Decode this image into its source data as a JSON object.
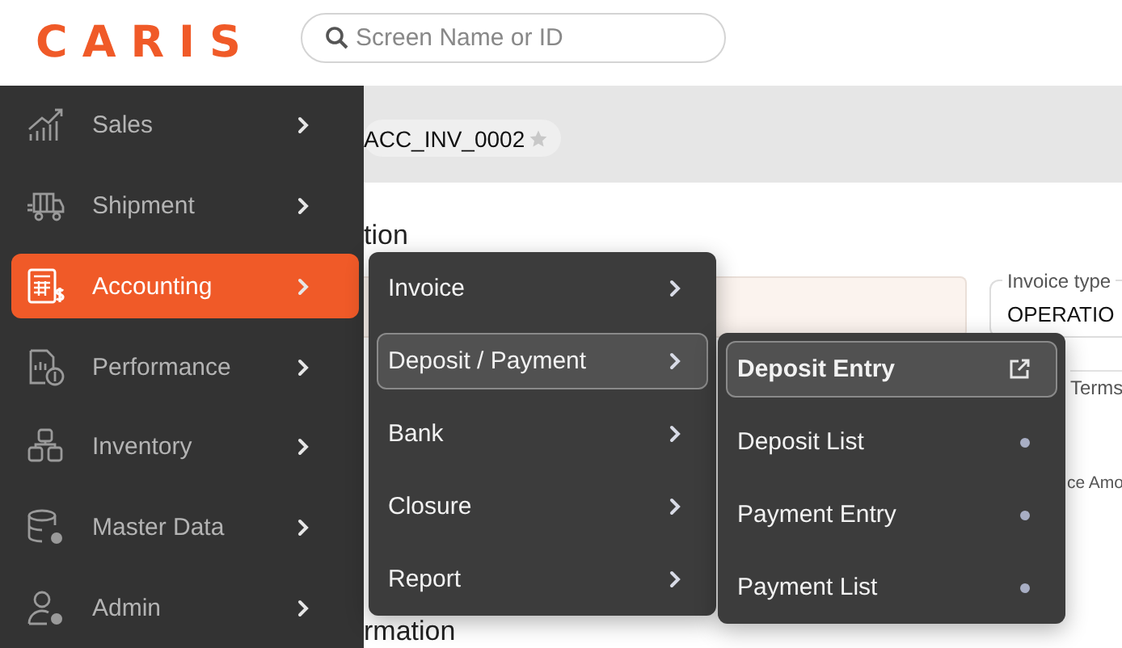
{
  "header": {
    "logo": "CARIS",
    "search": {
      "placeholder": "Screen Name or ID"
    }
  },
  "sidebar": {
    "items": [
      {
        "label": "Sales",
        "selected": false
      },
      {
        "label": "Shipment",
        "selected": false
      },
      {
        "label": "Accounting",
        "selected": true
      },
      {
        "label": "Performance",
        "selected": false
      },
      {
        "label": "Inventory",
        "selected": false
      },
      {
        "label": "Master Data",
        "selected": false
      },
      {
        "label": "Admin",
        "selected": false
      }
    ]
  },
  "accounting_menu": {
    "items": [
      {
        "label": "Invoice",
        "selected": false
      },
      {
        "label": "Deposit / Payment",
        "selected": true
      },
      {
        "label": "Bank",
        "selected": false
      },
      {
        "label": "Closure",
        "selected": false
      },
      {
        "label": "Report",
        "selected": false
      }
    ]
  },
  "deposit_payment_menu": {
    "items": [
      {
        "label": "Deposit Entry",
        "selected": true
      },
      {
        "label": "Deposit List",
        "selected": false
      },
      {
        "label": "Payment Entry",
        "selected": false
      },
      {
        "label": "Payment List",
        "selected": false
      }
    ]
  },
  "page": {
    "tab": "ACC_INV_0002",
    "section_title": "tion",
    "invoice_type": {
      "label": "Invoice type",
      "value": "OPERATIO"
    },
    "field_label_1": "Terms",
    "field_label_2": "ce Amo",
    "section_title_2": "rmation"
  }
}
